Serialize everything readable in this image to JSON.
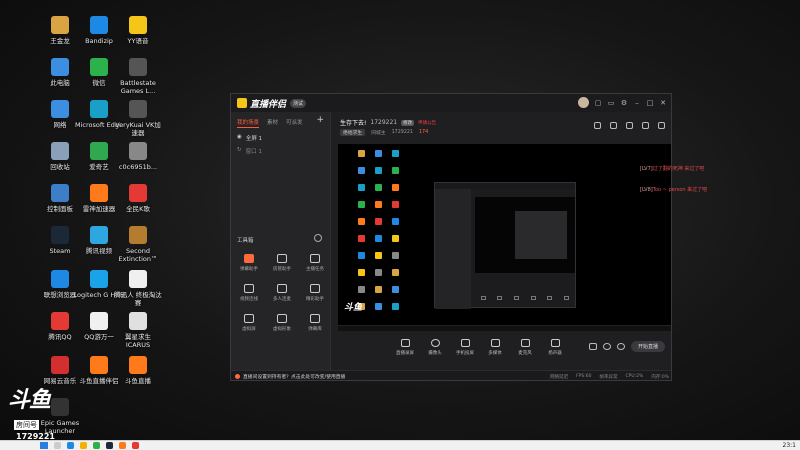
{
  "desktop": {
    "icons": [
      {
        "label": "王金龙",
        "icon": "folder-icon",
        "color": "#d9a441"
      },
      {
        "label": "此电脑",
        "icon": "computer-icon",
        "color": "#3c8ee0"
      },
      {
        "label": "网络",
        "icon": "network-icon",
        "color": "#3c8ee0"
      },
      {
        "label": "回收站",
        "icon": "recycle-bin-icon",
        "color": "#8aa0b8"
      },
      {
        "label": "控制面板",
        "icon": "control-panel-icon",
        "color": "#3c7ec8"
      },
      {
        "label": "Steam",
        "icon": "steam-icon",
        "color": "#1b2838"
      },
      {
        "label": "联想浏览器",
        "icon": "lenovo-browser-icon",
        "color": "#1e88e5"
      },
      {
        "label": "腾讯QQ",
        "icon": "qq-icon",
        "color": "#e53935"
      },
      {
        "label": "网易云音乐",
        "icon": "netease-music-icon",
        "color": "#d32f2f"
      },
      {
        "label": "Epic Games Launcher",
        "icon": "epic-icon",
        "color": "#333333"
      },
      {
        "label": "Bandizip",
        "icon": "bandizip-icon",
        "color": "#1e88e5"
      },
      {
        "label": "微信",
        "icon": "wechat-icon",
        "color": "#2bb24c"
      },
      {
        "label": "Microsoft Edge",
        "icon": "edge-icon",
        "color": "#1aa0c8"
      },
      {
        "label": "爱奇艺",
        "icon": "iqiyi-icon",
        "color": "#2fa84f"
      },
      {
        "label": "雷神加速器",
        "icon": "leishen-icon",
        "color": "#ff7a1a"
      },
      {
        "label": "腾讯视频",
        "icon": "tencent-video-icon",
        "color": "#2ea7e0"
      },
      {
        "label": "Logitech G HUB",
        "icon": "logitech-icon",
        "color": "#1aa3e8"
      },
      {
        "label": "QQ游万一",
        "icon": "file-icon",
        "color": "#f0f0f0"
      },
      {
        "label": "斗鱼直播伴侣",
        "icon": "douyu-icon",
        "color": "#ff7a1a"
      },
      {
        "label": "YY语音",
        "icon": "yy-icon",
        "color": "#f5c518"
      },
      {
        "label": "Battlestate Games L...",
        "icon": "battlestate-icon",
        "color": "#555555"
      },
      {
        "label": "VeryKuai VK加速器",
        "icon": "verykuai-icon",
        "color": "#555555"
      },
      {
        "label": "c0c6951b...",
        "icon": "file-icon",
        "color": "#888888"
      },
      {
        "label": "全民K歌",
        "icon": "kge-icon",
        "color": "#e53935"
      },
      {
        "label": "Second Extinction™",
        "icon": "game-icon",
        "color": "#b57b2e"
      },
      {
        "label": "腾迅人 终极淘汰赛",
        "icon": "file-icon",
        "color": "#f0f0f0"
      },
      {
        "label": "翼星求生 ICARUS",
        "icon": "icarus-icon",
        "color": "#e0e0e0"
      },
      {
        "label": "斗鱼直播",
        "icon": "douyu-icon",
        "color": "#ff7a1a"
      }
    ]
  },
  "app": {
    "name": "直播伴侣",
    "version_badge": "测试",
    "sidebar": {
      "tabs": [
        "我的场景",
        "素材",
        "可派发"
      ],
      "scene_label": "全屏 1",
      "scene_secondary": "窗口 1",
      "tools_label": "工具箱",
      "tools": [
        {
          "label": "弹幕助手",
          "hot": true
        },
        {
          "label": "房管助手",
          "hot": false
        },
        {
          "label": "主播任务",
          "hot": false
        },
        {
          "label": "视频连线",
          "hot": false
        },
        {
          "label": "多人连麦",
          "hot": false
        },
        {
          "label": "精彩助手",
          "hot": false
        },
        {
          "label": "虚拟屏",
          "hot": false
        },
        {
          "label": "虚拟形象",
          "hot": false
        },
        {
          "label": "弹幕库",
          "hot": false
        }
      ]
    },
    "header": {
      "title": "生存下去!",
      "room_id": "1729221",
      "tag_edit": "修改",
      "tag_red": "申请公告",
      "category": "绝地求生",
      "sub_label": "同城主",
      "sub_id": "1729221",
      "hot_count": "174"
    },
    "preview": {
      "watermark": "斗鱼"
    },
    "controls": [
      {
        "label": "直播录屏",
        "icon": "screen-record-icon"
      },
      {
        "label": "摄像头",
        "icon": "camera-icon"
      },
      {
        "label": "手机投屏",
        "icon": "phone-cast-icon"
      },
      {
        "label": "多媒体",
        "icon": "media-icon"
      },
      {
        "label": "麦克风",
        "icon": "microphone-icon"
      },
      {
        "label": "扬声器",
        "icon": "speaker-icon"
      }
    ],
    "go_live": "开始直播",
    "status": {
      "warning": "直播间设置到持有者？点击此处可改变/使用直播",
      "stats": [
        "网络延迟",
        "FPS:60",
        "帧率异常",
        "CPU:2%",
        "内存:0%"
      ]
    }
  },
  "chat": [
    {
      "name": "[LV7]",
      "text": "过了翻的死神 来过了吧"
    },
    {
      "name": "[LV8]",
      "text": "Too ~ person 来过了吧"
    }
  ],
  "douyu_watermark": {
    "logo": "斗鱼",
    "sub": "房间号",
    "room_id": "1729221"
  },
  "taskbar": {
    "clock": "23:1"
  }
}
